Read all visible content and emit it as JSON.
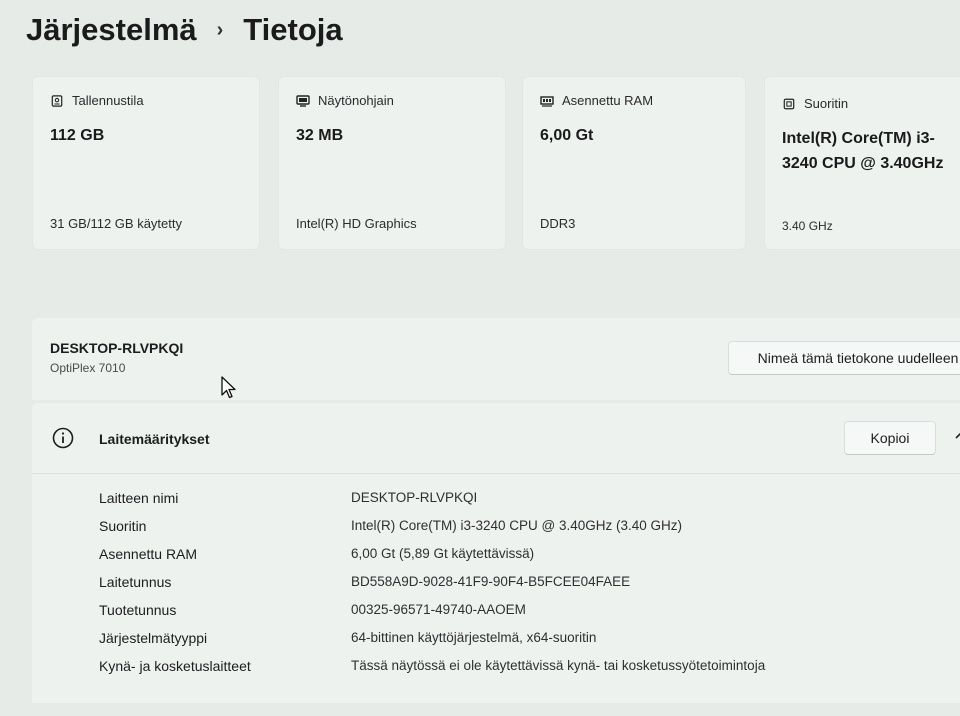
{
  "breadcrumb": {
    "parent": "Järjestelmä",
    "separator": "›",
    "current": "Tietoja"
  },
  "cards": [
    {
      "icon": "storage-icon",
      "title": "Tallennustila",
      "value": "112 GB",
      "sub": "31 GB/112 GB käytetty"
    },
    {
      "icon": "display-adapter-icon",
      "title": "Näytönohjain",
      "value": "32 MB",
      "sub": "Intel(R) HD Graphics"
    },
    {
      "icon": "ram-icon",
      "title": "Asennettu RAM",
      "value": "6,00 Gt",
      "sub": "DDR3"
    },
    {
      "icon": "processor-icon",
      "title": "Suoritin",
      "value": "Intel(R) Core(TM) i3-3240 CPU @ 3.40GHz",
      "sub": "3.40 GHz"
    }
  ],
  "device": {
    "name": "DESKTOP-RLVPKQI",
    "model": "OptiPlex 7010",
    "rename_label": "Nimeä tämä tietokone uudelleen"
  },
  "specs": {
    "icon": "info-icon",
    "title": "Laitemääritykset",
    "copy_label": "Kopioi",
    "rows": [
      {
        "label": "Laitteen nimi",
        "value": "DESKTOP-RLVPKQI"
      },
      {
        "label": "Suoritin",
        "value": "Intel(R) Core(TM) i3-3240 CPU @ 3.40GHz (3.40 GHz)"
      },
      {
        "label": "Asennettu RAM",
        "value": "6,00 Gt (5,89 Gt käytettävissä)"
      },
      {
        "label": "Laitetunnus",
        "value": "BD558A9D-9028-41F9-90F4-B5FCEE04FAEE"
      },
      {
        "label": "Tuotetunnus",
        "value": "00325-96571-49740-AAOEM"
      },
      {
        "label": "Järjestelmätyyppi",
        "value": "64-bittinen käyttöjärjestelmä, x64-suoritin"
      },
      {
        "label": "Kynä- ja kosketuslaitteet",
        "value": "Tässä näytössä ei ole käytettävissä kynä- tai kosketussyötetoimintoja"
      }
    ]
  }
}
